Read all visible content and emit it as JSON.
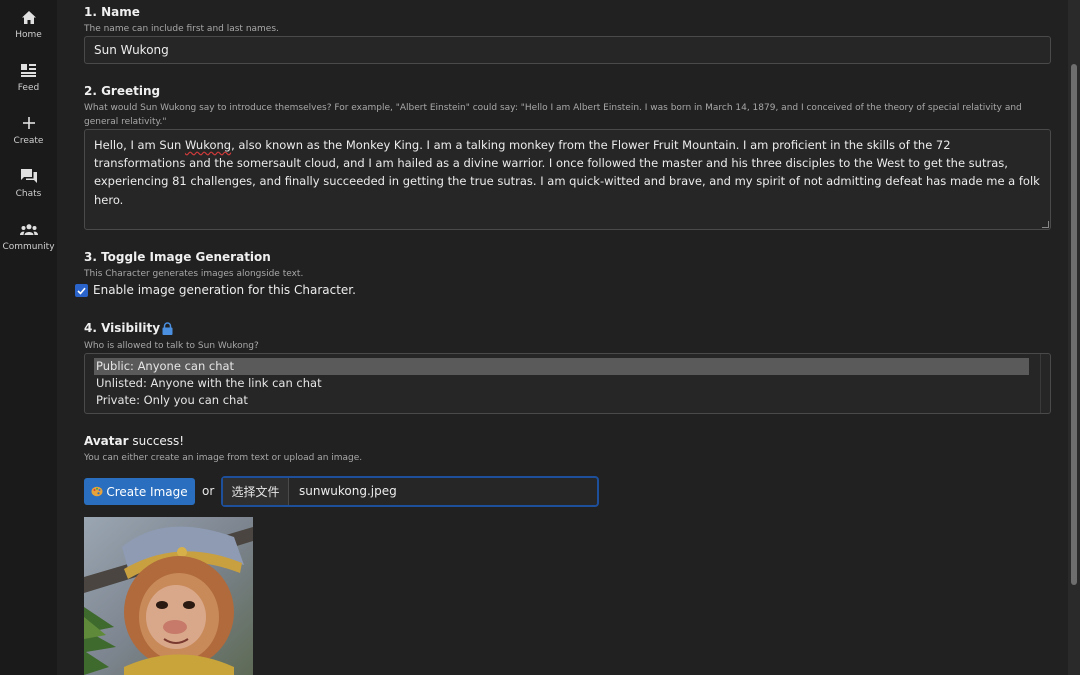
{
  "sidebar": {
    "items": [
      {
        "label": "Home",
        "icon": "home-icon"
      },
      {
        "label": "Feed",
        "icon": "feed-icon"
      },
      {
        "label": "Create",
        "icon": "plus-icon"
      },
      {
        "label": "Chats",
        "icon": "chat-icon"
      },
      {
        "label": "Community",
        "icon": "community-icon"
      }
    ]
  },
  "name": {
    "title": "1. Name",
    "hint": "The name can include first and last names.",
    "value": "Sun Wukong"
  },
  "greeting": {
    "title": "2. Greeting",
    "hint_line1": "What would Sun Wukong say to introduce themselves? For example, \"Albert Einstein\" could say: \"Hello I am Albert Einstein. I was born in March 14, 1879, and I conceived of the theory of special relativity and",
    "hint_line2": "general relativity.\"",
    "value_before": "Hello, I am Sun ",
    "value_misspelled": "Wukong",
    "value_after": ", also known as the Monkey King. I am a talking monkey from the Flower Fruit Mountain. I am proficient in the skills of the 72 transformations and the somersault cloud, and I am hailed as a divine warrior. I once followed the master and his three disciples to the West to get the sutras, experiencing 81 challenges, and finally succeeded in getting the true sutras. I am quick-witted and brave, and my spirit of not admitting defeat has made me a folk hero."
  },
  "image_generation": {
    "title": "3. Toggle Image Generation",
    "hint": "This Character generates images alongside text.",
    "checkbox_label": "Enable image generation for this Character.",
    "checked": true
  },
  "visibility": {
    "title": "4. Visibility",
    "hint": "Who is allowed to talk to Sun Wukong?",
    "options": [
      "Public: Anyone can chat",
      "Unlisted: Anyone with the link can chat",
      "Private: Only you can chat"
    ],
    "selected": "Public: Anyone can chat"
  },
  "avatar": {
    "title": "Avatar",
    "status": "success!",
    "hint": "You can either create an image from text or upload an image.",
    "create_button": "Create Image",
    "or_text": "or",
    "file_button": "选择文件",
    "file_name": "sunwukong.jpeg"
  },
  "colors": {
    "background": "#212121",
    "sidebar": "#1a1a1a",
    "accent": "#2a6fbf"
  }
}
